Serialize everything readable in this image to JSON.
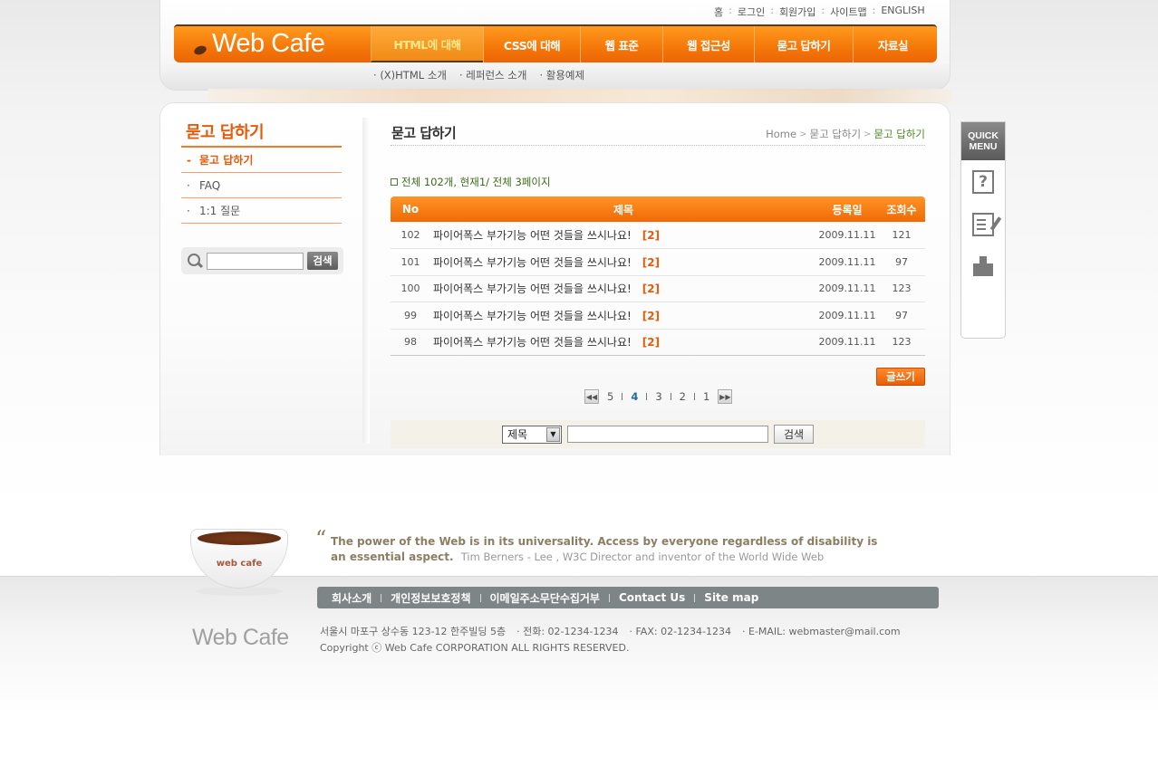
{
  "util_links": [
    "홈",
    "로그인",
    "회원가입",
    "사이트맵",
    "ENGLISH"
  ],
  "logo": "Web Cafe",
  "gnb": [
    {
      "label": "HTML에 대해",
      "width": 124,
      "active": true
    },
    {
      "label": "CSS에 대해",
      "width": 107,
      "active": false
    },
    {
      "label": "웹 표준",
      "width": 91,
      "active": false
    },
    {
      "label": "웹 접근성",
      "width": 101,
      "active": false
    },
    {
      "label": "묻고 답하기",
      "width": 109,
      "active": false
    },
    {
      "label": "자료실",
      "width": 88,
      "active": false
    }
  ],
  "sub_menu": [
    "(X)HTML 소개",
    "레퍼런스 소개",
    "활용예제"
  ],
  "lnb": {
    "title": "묻고 답하기",
    "items": [
      {
        "bullet": "-",
        "label": "묻고 답하기",
        "active": true
      },
      {
        "bullet": "·",
        "label": "FAQ",
        "active": false
      },
      {
        "bullet": "·",
        "label": "1:1 질문",
        "active": false
      }
    ],
    "search_button": "검색"
  },
  "main": {
    "title": "묻고 답하기",
    "breadcrumb": [
      "Home",
      "묻고 답하기",
      "묻고 답하기"
    ],
    "summary": "전체 102개, 현재1/ 전체 3페이지"
  },
  "board": {
    "columns": [
      "No",
      "제목",
      "등록일",
      "조회수"
    ],
    "rows": [
      {
        "no": "102",
        "title": "파이어폭스 부가기능 어떤 것들을 쓰시나요!",
        "comments": "[2]",
        "date": "2009.11.11",
        "hits": "121"
      },
      {
        "no": "101",
        "title": "파이어폭스 부가기능 어떤 것들을 쓰시나요!",
        "comments": "[2]",
        "date": "2009.11.11",
        "hits": "97"
      },
      {
        "no": "100",
        "title": "파이어폭스 부가기능 어떤 것들을 쓰시나요!",
        "comments": "[2]",
        "date": "2009.11.11",
        "hits": "123"
      },
      {
        "no": "99",
        "title": "파이어폭스 부가기능 어떤 것들을 쓰시나요!",
        "comments": "[2]",
        "date": "2009.11.11",
        "hits": "97"
      },
      {
        "no": "98",
        "title": "파이어폭스 부가기능 어떤 것들을 쓰시나요!",
        "comments": "[2]",
        "date": "2009.11.11",
        "hits": "123"
      }
    ],
    "write_button": "글쓰기",
    "pages": [
      "5",
      "4",
      "3",
      "2",
      "1"
    ],
    "current_page": "4",
    "search": {
      "select_value": "제목",
      "button": "검색"
    }
  },
  "quick_menu": {
    "title_line1": "QUICK",
    "title_line2": "MENU",
    "icons": [
      "help-icon",
      "write-icon",
      "box-icon",
      "board-icon"
    ]
  },
  "footer": {
    "cup_label": "web cafe",
    "quote": "The power of the Web is in its universality. Access by everyone regardless of disability is an essential aspect.",
    "quote_author": "Tim Berners - Lee , W3C Director and inventor of the World Wide Web",
    "nav": [
      "회사소개",
      "개인정보보호정책",
      "이메일주소무단수집거부",
      "Contact Us",
      "Site map"
    ],
    "logo": "Web Cafe",
    "address": "서울시 마포구 상수동 123-12 한주빌딩 5층",
    "phone": "· 전화: 02-1234-1234",
    "fax": "· FAX: 02-1234-1234",
    "email": "· E-MAIL: webmaster@mail.com",
    "copyright": "Copyright ⓒ Web Cafe CORPORATION ALL RIGHTS RESERVED."
  },
  "colors": {
    "accent": "#f57a0a",
    "breadcrumb_current": "#4b8a24",
    "summary": "#3a6b1a"
  }
}
